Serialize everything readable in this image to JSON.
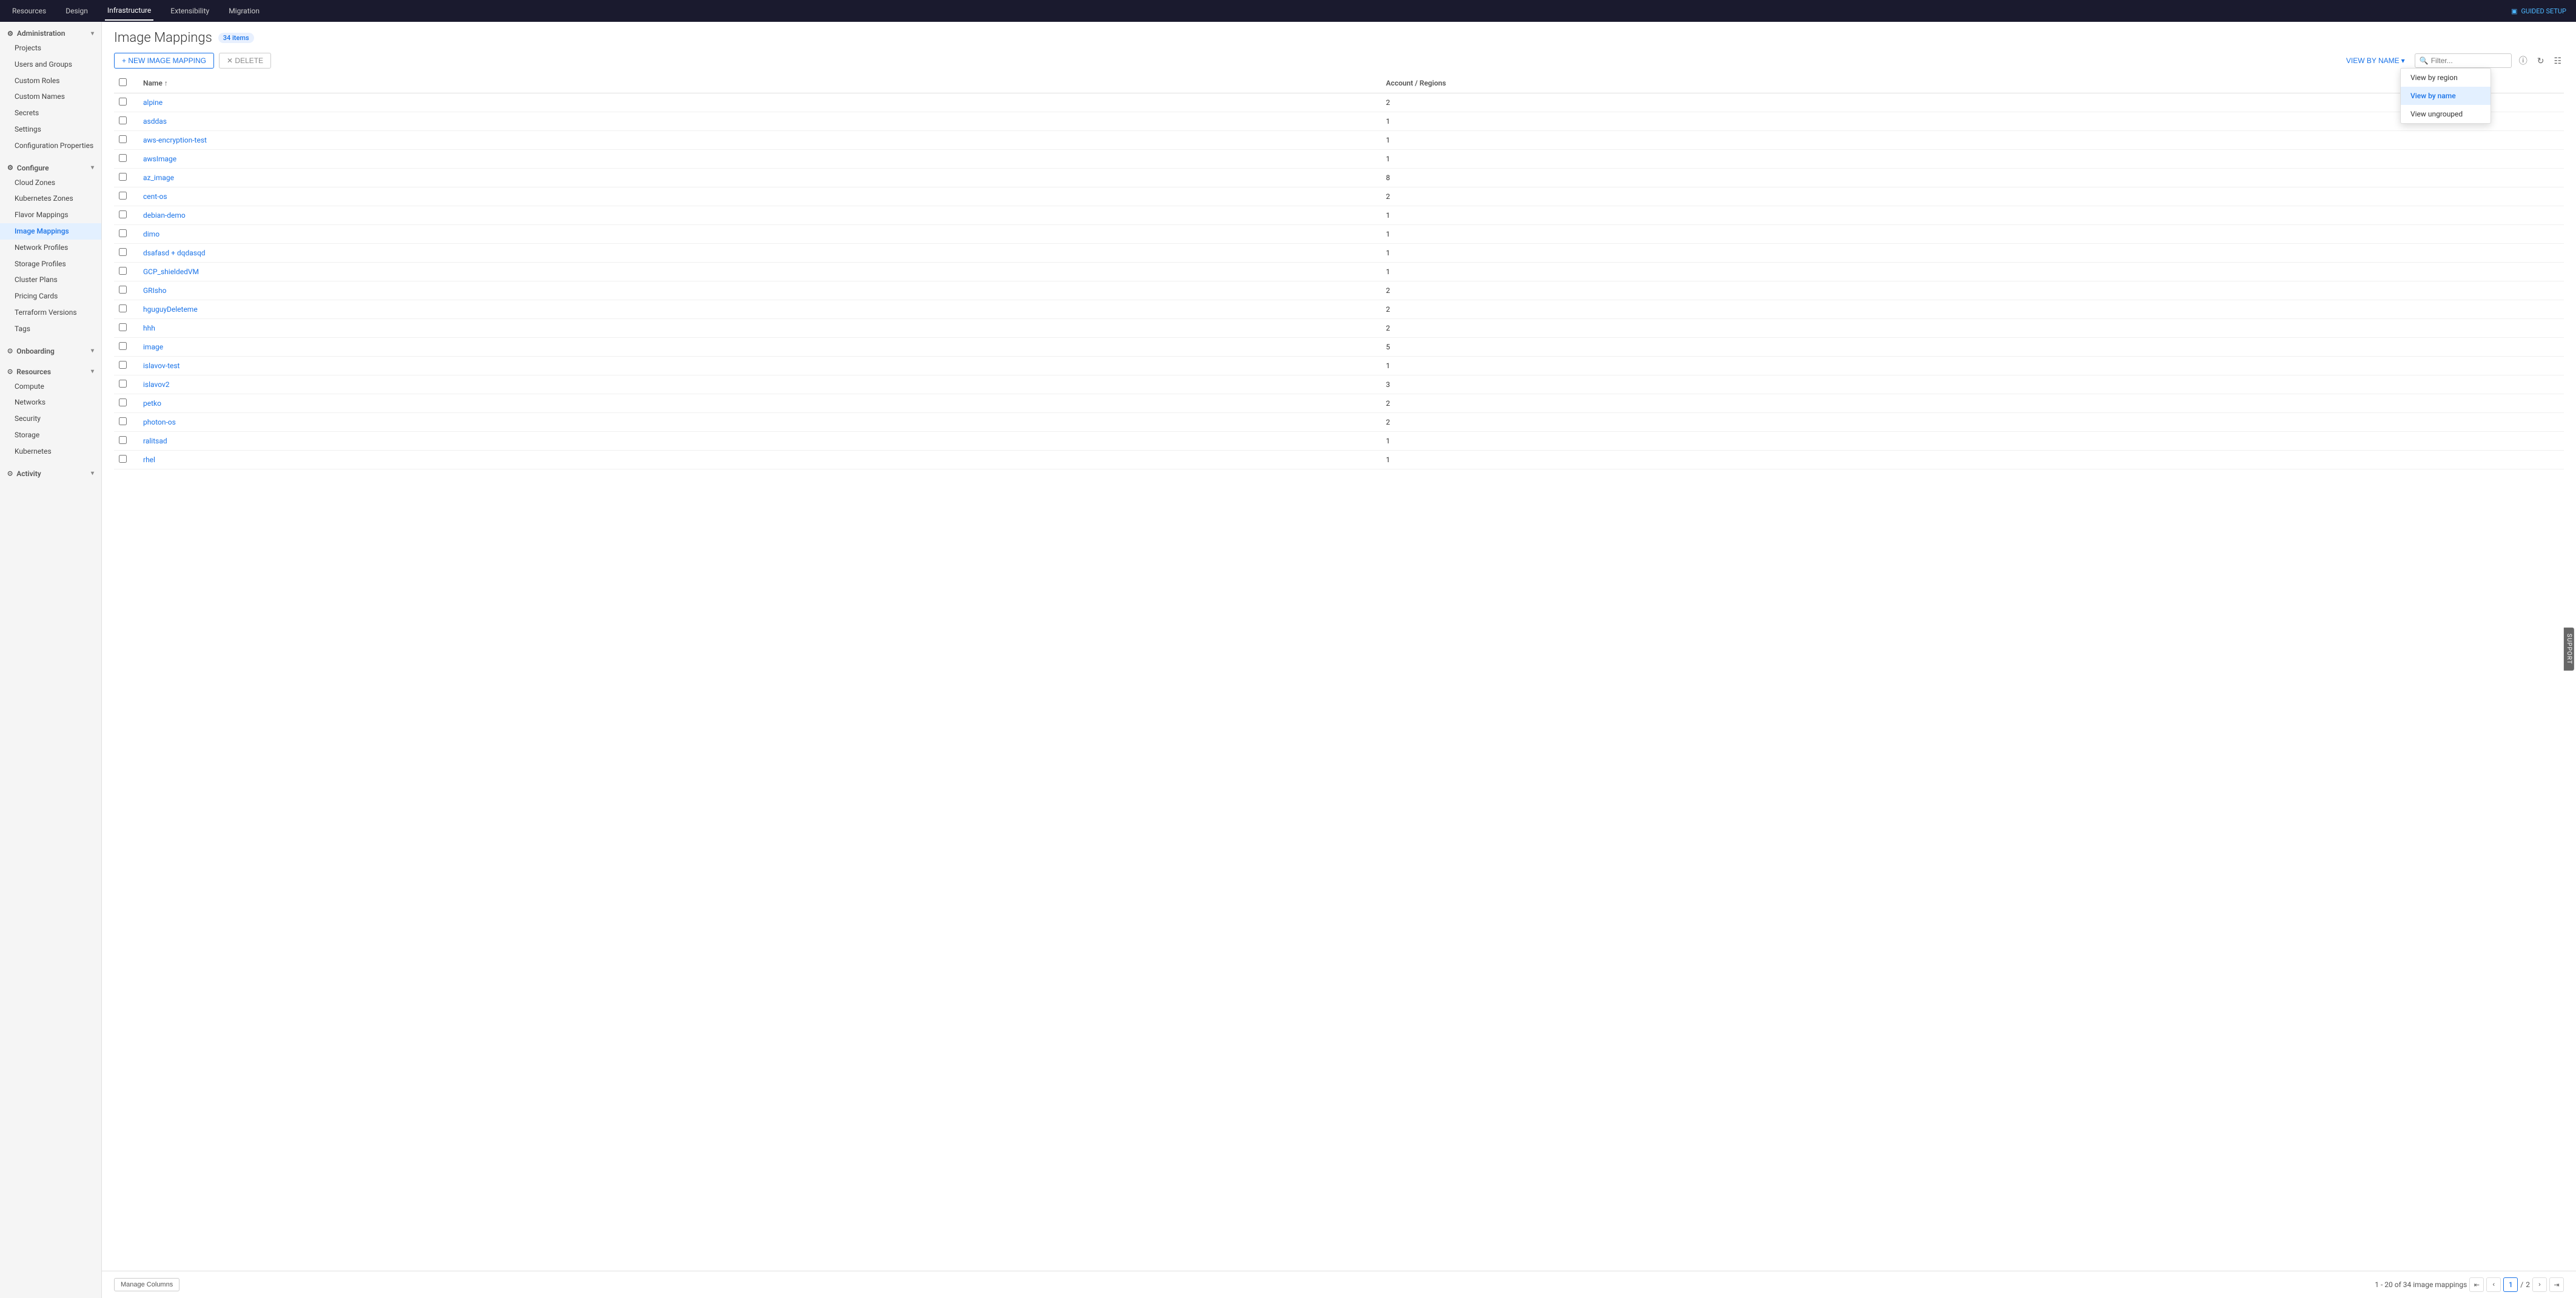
{
  "topNav": {
    "items": [
      {
        "label": "Resources",
        "active": false
      },
      {
        "label": "Design",
        "active": false
      },
      {
        "label": "Infrastructure",
        "active": true
      },
      {
        "label": "Extensibility",
        "active": false
      },
      {
        "label": "Migration",
        "active": false
      }
    ],
    "guidedSetup": "GUIDED SETUP"
  },
  "sidebar": {
    "collapseIcon": "«",
    "sections": [
      {
        "label": "Administration",
        "expanded": true,
        "items": [
          {
            "label": "Projects",
            "active": false
          },
          {
            "label": "Users and Groups",
            "active": false
          },
          {
            "label": "Custom Roles",
            "active": false
          },
          {
            "label": "Custom Names",
            "active": false
          },
          {
            "label": "Secrets",
            "active": false
          },
          {
            "label": "Settings",
            "active": false
          },
          {
            "label": "Configuration Properties",
            "active": false
          }
        ]
      },
      {
        "label": "Configure",
        "expanded": true,
        "items": [
          {
            "label": "Cloud Zones",
            "active": false
          },
          {
            "label": "Kubernetes Zones",
            "active": false
          },
          {
            "label": "Flavor Mappings",
            "active": false
          },
          {
            "label": "Image Mappings",
            "active": true
          },
          {
            "label": "Network Profiles",
            "active": false
          },
          {
            "label": "Storage Profiles",
            "active": false
          },
          {
            "label": "Cluster Plans",
            "active": false
          },
          {
            "label": "Pricing Cards",
            "active": false
          },
          {
            "label": "Terraform Versions",
            "active": false
          },
          {
            "label": "Tags",
            "active": false
          }
        ]
      },
      {
        "label": "Onboarding",
        "expanded": true,
        "items": []
      },
      {
        "label": "Resources",
        "expanded": true,
        "items": [
          {
            "label": "Compute",
            "active": false
          },
          {
            "label": "Networks",
            "active": false
          },
          {
            "label": "Security",
            "active": false
          },
          {
            "label": "Storage",
            "active": false
          },
          {
            "label": "Kubernetes",
            "active": false
          }
        ]
      },
      {
        "label": "Activity",
        "expanded": true,
        "items": []
      }
    ]
  },
  "page": {
    "title": "Image Mappings",
    "itemCount": "34 items",
    "newButtonLabel": "+ NEW IMAGE MAPPING",
    "deleteButtonLabel": "✕ DELETE"
  },
  "toolbar": {
    "viewByLabel": "VIEW BY NAME",
    "viewByChevron": "▾",
    "filterPlaceholder": "Filter..."
  },
  "dropdown": {
    "items": [
      {
        "label": "View by region",
        "active": false
      },
      {
        "label": "View by name",
        "active": true
      },
      {
        "label": "View ungrouped",
        "active": false
      }
    ]
  },
  "table": {
    "columns": [
      {
        "label": "Name",
        "sortable": true
      },
      {
        "label": "Account / Regions",
        "sortable": false
      }
    ],
    "rows": [
      {
        "name": "alpine",
        "regions": "2"
      },
      {
        "name": "asddas",
        "regions": "1"
      },
      {
        "name": "aws-encryption-test",
        "regions": "1"
      },
      {
        "name": "awsImage",
        "regions": "1"
      },
      {
        "name": "az_image",
        "regions": "8"
      },
      {
        "name": "cent-os",
        "regions": "2"
      },
      {
        "name": "debian-demo",
        "regions": "1"
      },
      {
        "name": "dimo",
        "regions": "1"
      },
      {
        "name": "dsafasd + dqdasqd",
        "regions": "1"
      },
      {
        "name": "GCP_shieldedVM",
        "regions": "1"
      },
      {
        "name": "GRIsho",
        "regions": "2"
      },
      {
        "name": "hguguyDeleteme",
        "regions": "2"
      },
      {
        "name": "hhh",
        "regions": "2"
      },
      {
        "name": "image",
        "regions": "5"
      },
      {
        "name": "islavov-test",
        "regions": "1"
      },
      {
        "name": "islavov2",
        "regions": "3"
      },
      {
        "name": "petko",
        "regions": "2"
      },
      {
        "name": "photon-os",
        "regions": "2"
      },
      {
        "name": "ralitsad",
        "regions": "1"
      },
      {
        "name": "rhel",
        "regions": "1"
      }
    ]
  },
  "footer": {
    "manageColumnsLabel": "Manage Columns",
    "paginationInfo": "1 - 20 of 34 image mappings",
    "currentPage": "1",
    "totalPages": "2"
  },
  "support": "SUPPORT"
}
